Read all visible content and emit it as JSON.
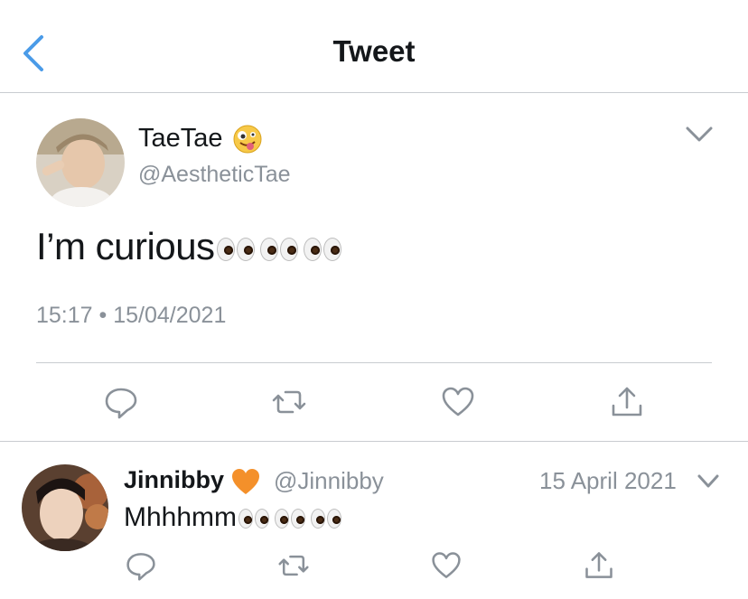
{
  "header": {
    "title": "Tweet",
    "back_icon": "chevron-left-icon",
    "accent": "#4a9be8"
  },
  "main_tweet": {
    "display_name": "TaeTae",
    "name_emoji": "zany-face-emoji",
    "handle": "@AestheticTae",
    "text": "I’m curious",
    "text_emoji": "eyes-emoji x3",
    "time": "15:17",
    "separator": "•",
    "date": "15/04/2021",
    "actions": [
      "reply-icon",
      "retweet-icon",
      "like-icon",
      "share-icon"
    ]
  },
  "reply": {
    "display_name": "Jinnibby",
    "name_emoji": "orange-heart-emoji",
    "handle": "@Jinnibby",
    "date": "15 April 2021",
    "text": "Mhhhmm",
    "text_emoji": "eyes-emoji x3",
    "actions": [
      "reply-icon",
      "retweet-icon",
      "like-icon",
      "share-icon"
    ]
  },
  "colors": {
    "icon_gray": "#8a9199",
    "divider": "#c9ccd0",
    "heart": "#f4902a"
  }
}
